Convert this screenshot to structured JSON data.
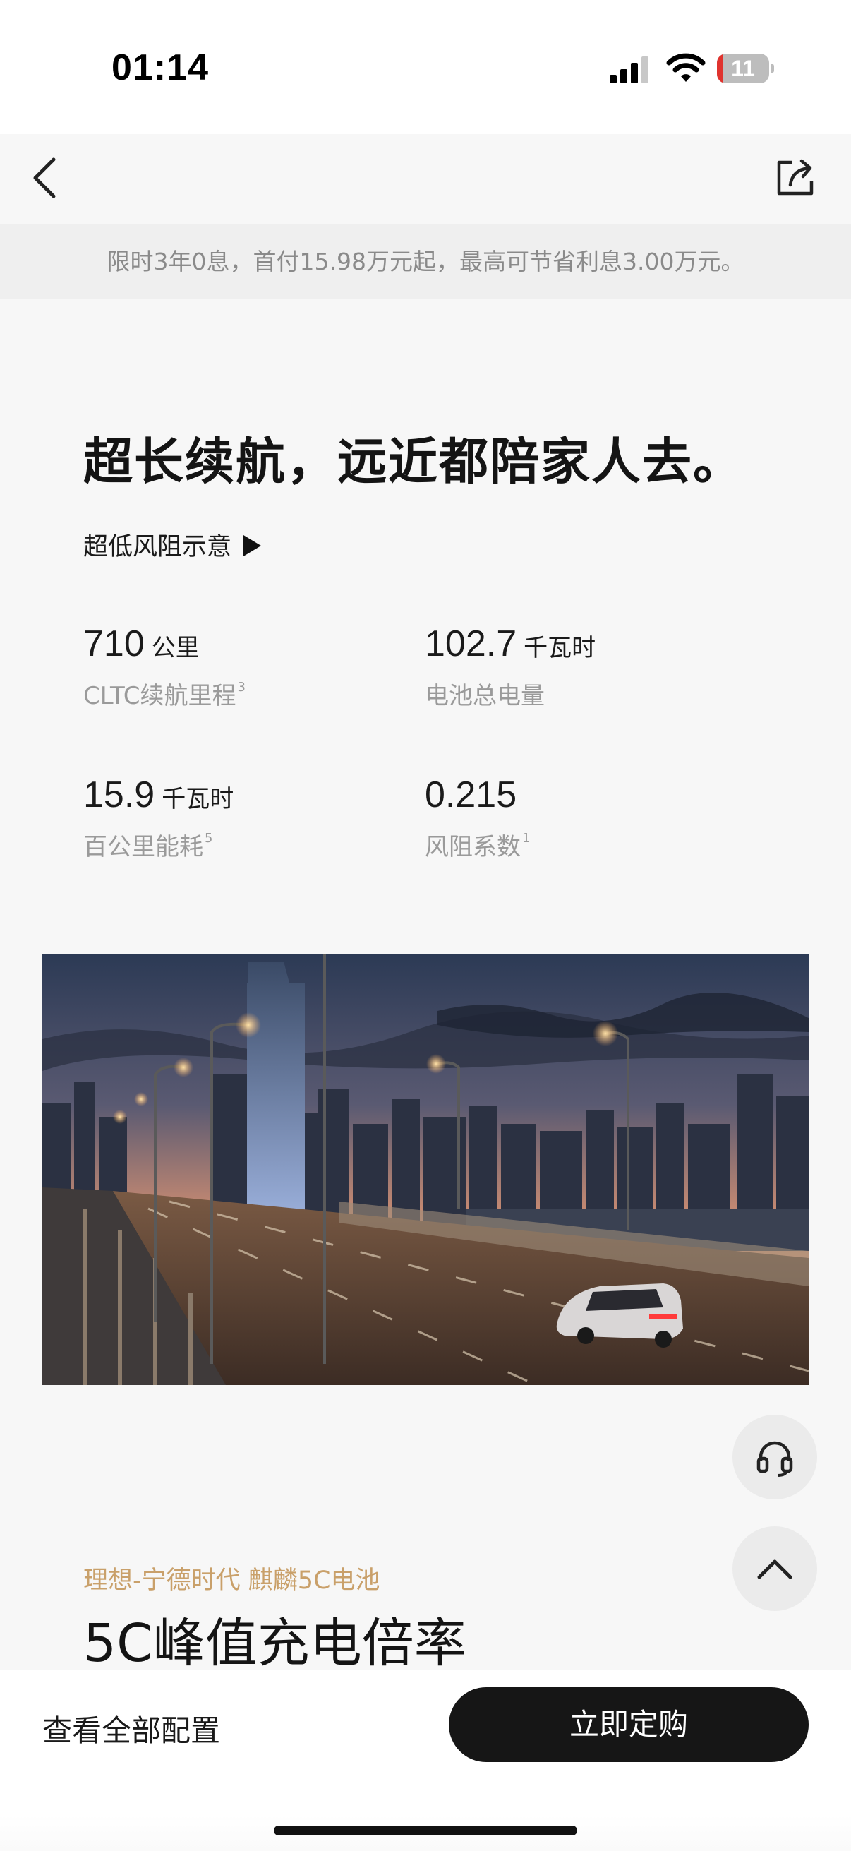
{
  "status_bar": {
    "time": "01:14",
    "battery_level": "11",
    "battery_fraction": 0.11
  },
  "promo": {
    "text": "限时3年0息，首付15.98万元起，最高可节省利息3.00万元。"
  },
  "hero": {
    "headline": "超长续航，远近都陪家人去。",
    "aero_link": "超低风阻示意"
  },
  "specs": [
    {
      "value": "710",
      "unit": "公里",
      "label": "CLTC续航里程",
      "note": "3"
    },
    {
      "value": "102.7",
      "unit": "千瓦时",
      "label": "电池总电量",
      "note": ""
    },
    {
      "value": "15.9",
      "unit": "千瓦时",
      "label": "百公里能耗",
      "note": "5"
    },
    {
      "value": "0.215",
      "unit": "",
      "label": "风阻系数",
      "note": "1"
    }
  ],
  "section": {
    "kicker": "理想-宁德时代 麒麟5C电池",
    "title": "5C峰值充电倍率"
  },
  "bottom_bar": {
    "config_link": "查看全部配置",
    "order_button": "立即定购"
  },
  "icons": {
    "back": "chevron-left-icon",
    "share": "share-icon",
    "support": "headset-icon",
    "scroll_top": "chevron-up-icon",
    "play": "play-icon"
  },
  "colors": {
    "accent_gold": "#c9a06a",
    "button_dark": "#161616",
    "battery_low": "#e0332e"
  }
}
